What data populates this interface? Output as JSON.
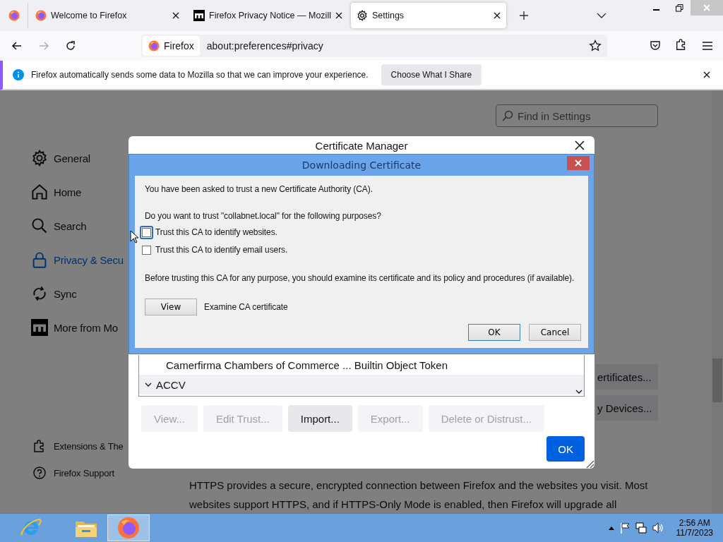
{
  "tabs": [
    {
      "kind": "firefox-view",
      "selected": false
    },
    {
      "kind": "firefox",
      "title": "Welcome to Firefox",
      "selected": false
    },
    {
      "kind": "mozilla",
      "title": "Firefox Privacy Notice — Mozill",
      "selected": false
    },
    {
      "kind": "settings",
      "title": "Settings",
      "selected": true
    }
  ],
  "nav_buttons": [
    {
      "kind": "back",
      "disabled": false
    },
    {
      "kind": "forward",
      "disabled": true
    },
    {
      "kind": "reload",
      "disabled": false
    }
  ],
  "url_bar": {
    "identity": "Firefox",
    "url": "about:preferences#privacy"
  },
  "notification": {
    "message": "Firefox automatically sends some data to Mozilla so that we can improve your experience.",
    "button": "Choose What I Share"
  },
  "settings": {
    "search": {
      "placeholder": "Find in Settings"
    },
    "sidebar": [
      {
        "kind": "gear",
        "label": "General",
        "selected": false
      },
      {
        "kind": "home",
        "label": "Home",
        "selected": false
      },
      {
        "kind": "search",
        "label": "Search",
        "selected": false
      },
      {
        "kind": "lock",
        "label": "Privacy & Secu",
        "selected": true
      },
      {
        "kind": "sync",
        "label": "Sync",
        "selected": false
      },
      {
        "kind": "mozilla",
        "label": "More from Mo",
        "selected": false
      }
    ],
    "sidebar_footer": [
      {
        "kind": "puzzle",
        "label": "Extensions & The"
      },
      {
        "kind": "help",
        "label": "Firefox Support"
      }
    ],
    "side_buttons": [
      "ertificates...",
      "y Devices..."
    ],
    "https_text": [
      "HTTPS provides a secure, encrypted connection between Firefox and the websites you visit. Most",
      "websites support HTTPS, and if HTTPS-Only Mode is enabled, then Firefox will upgrade all"
    ]
  },
  "certificate_manager": {
    "title": "Certificate Manager",
    "rows": [
      {
        "kind": "item",
        "label": "Camerfirma Chambers of Commerce ... Builtin Object Token"
      },
      {
        "kind": "group",
        "label": "ACCV",
        "expanded": true
      }
    ],
    "buttons": [
      {
        "label": "View...",
        "disabled": true
      },
      {
        "label": "Edit Trust...",
        "disabled": true
      },
      {
        "label": "Import...",
        "disabled": false
      },
      {
        "label": "Export...",
        "disabled": true
      },
      {
        "label": "Delete or Distrust...",
        "disabled": true
      }
    ],
    "ok": "OK"
  },
  "download_dialog": {
    "title": "Downloading Certificate",
    "intro": "You have been asked to trust a new Certificate Authority (CA).",
    "question": "Do you want to trust \"collabnet.local\" for the following purposes?",
    "options": [
      {
        "label": "Trust this CA to identify websites.",
        "checked": false,
        "focused": true
      },
      {
        "label": "Trust this CA to identify email users.",
        "checked": false,
        "focused": false
      }
    ],
    "advice": "Before trusting this CA for any purpose, you should examine its certificate and its policy and procedures (if available).",
    "view_button": "View",
    "view_label": "Examine CA certificate",
    "buttons": [
      {
        "label": "OK",
        "default": true
      },
      {
        "label": "Cancel",
        "default": false
      }
    ]
  },
  "taskbar": {
    "apps": [
      {
        "kind": "ie",
        "active": false
      },
      {
        "kind": "explorer",
        "active": false
      },
      {
        "kind": "firefox",
        "active": true
      }
    ],
    "time": "2:56 AM",
    "date": "11/7/2023"
  }
}
